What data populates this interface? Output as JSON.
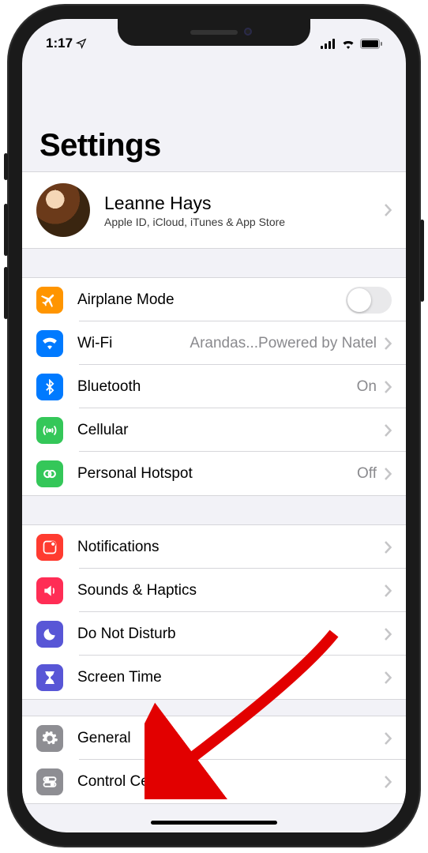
{
  "status": {
    "time": "1:17"
  },
  "header": {
    "title": "Settings"
  },
  "profile": {
    "name": "Leanne Hays",
    "subtitle": "Apple ID, iCloud, iTunes & App Store"
  },
  "rows": {
    "airplane": {
      "label": "Airplane Mode"
    },
    "wifi": {
      "label": "Wi-Fi",
      "value": "Arandas...Powered by Natel"
    },
    "bluetooth": {
      "label": "Bluetooth",
      "value": "On"
    },
    "cellular": {
      "label": "Cellular"
    },
    "hotspot": {
      "label": "Personal Hotspot",
      "value": "Off"
    },
    "notifications": {
      "label": "Notifications"
    },
    "sounds": {
      "label": "Sounds & Haptics"
    },
    "dnd": {
      "label": "Do Not Disturb"
    },
    "screentime": {
      "label": "Screen Time"
    },
    "general": {
      "label": "General"
    },
    "control": {
      "label": "Control Center"
    }
  },
  "colors": {
    "airplane": "#ff9500",
    "wifi": "#007aff",
    "bluetooth": "#007aff",
    "cellular": "#34c759",
    "hotspot": "#34c759",
    "notifications": "#ff3b30",
    "sounds": "#ff2d55",
    "dnd": "#5856d6",
    "screentime": "#5856d6",
    "general": "#8e8e93",
    "control": "#8e8e93"
  }
}
